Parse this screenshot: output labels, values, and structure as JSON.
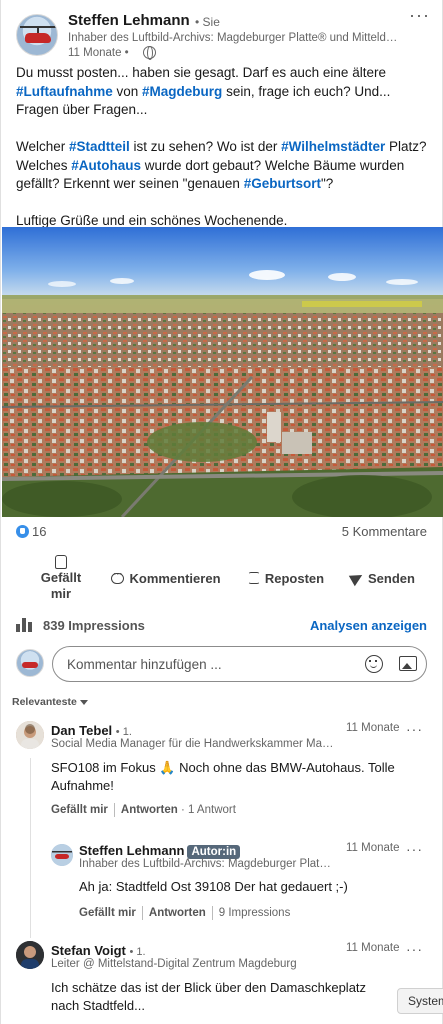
{
  "post": {
    "author_name": "Steffen Lehmann",
    "follow_status": "• Sie",
    "author_headline": "Inhaber des Luftbild-Archivs: Magdeburger Platte® und Mitteldeutschland",
    "time": "11 Monate •",
    "more_label": "···",
    "text": {
      "p1_a": "Du musst posten... haben sie gesagt. Darf es auch eine ältere ",
      "tag_luftaufnahme": "#Luftaufnahme",
      "p1_b": " von ",
      "tag_magdeburg": "#Magdeburg",
      "p1_c": " sein, frage ich euch? Und... Fragen über Fragen...",
      "p2_a": "Welcher ",
      "tag_stadtteil": "#Stadtteil",
      "p2_b": " ist zu sehen? Wo ist der ",
      "tag_wilhelmstaedter": "#Wilhelmstädter",
      "p2_c": " Platz? Welches ",
      "tag_autohaus": "#Autohaus",
      "p2_d": " wurde dort gebaut? Welche Bäume wurden gefällt? Erkennt wer seinen \"genauen ",
      "tag_geburtsort": "#Geburtsort",
      "p2_e": "\"?",
      "p3": "Luftige Grüße und ein schönes Wochenende."
    }
  },
  "stats": {
    "reactions": "16",
    "comments": "5 Kommentare"
  },
  "actions": {
    "like": "Gefällt mir",
    "comment": "Kommentieren",
    "repost": "Reposten",
    "send": "Senden"
  },
  "impressions": {
    "text": "839 Impressions",
    "analytics": "Analysen anzeigen"
  },
  "composer": {
    "placeholder": "Kommentar hinzufügen ..."
  },
  "sort_label": "Relevanteste",
  "comments": [
    {
      "name": "Dan Tebel",
      "degree": "• 1.",
      "headline": "Social Media Manager für die Handwerkskammer Magdeburg",
      "time": "11 Monate",
      "text": "SFO108 im Fokus 🙏 Noch ohne das BMW-Autohaus. Tolle Aufnahme!",
      "like": "Gefällt mir",
      "reply": "Antworten",
      "meta": "· 1 Antwort"
    },
    {
      "name": "Steffen Lehmann",
      "badge": "Autor:in",
      "headline": "Inhaber des Luftbild-Archivs: Magdeburger Platte® und Mitteldeutschland",
      "time": "11 Monate",
      "text": "Ah ja: Stadtfeld Ost 39108 Der hat gedauert ;-)",
      "like": "Gefällt mir",
      "reply": "Antworten",
      "meta": "9 Impressions"
    },
    {
      "name": "Stefan Voigt",
      "degree": "• 1.",
      "headline": "Leiter @ Mittelstand-Digital Zentrum Magdeburg",
      "time": "11 Monate",
      "text": "Ich schätze das ist der Blick über den Damaschkeplatz nach Stadtfeld..."
    }
  ],
  "system_tab": "System",
  "colors": {
    "link_blue": "#0a66c2",
    "reaction_blue": "#378fe9",
    "author_badge": "#56687a"
  }
}
